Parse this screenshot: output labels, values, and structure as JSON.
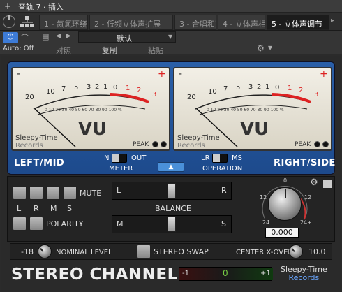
{
  "host": {
    "title": "音轨 7 · 插入",
    "tabs": [
      "1 - 氤氲环绕",
      "2 - 低频立体声扩展",
      "3 - 合唱和声",
      "4 - 立体声相",
      "5 - 立体声调节"
    ],
    "auto_label": "Auto: Off",
    "preset": "默认",
    "compare_label": "对照",
    "copy_label": "复制",
    "paste_label": "粘贴"
  },
  "meters": {
    "left": {
      "minus": "-",
      "plus": "+",
      "vu": "VU",
      "peak": "PEAK",
      "brand": "Sleepy-Time",
      "brand_sub": "Records",
      "scale_top": [
        "20",
        "10",
        "7",
        "5",
        "3",
        "2",
        "1",
        "0",
        "1",
        "2",
        "3"
      ],
      "scale_pct": "0 10 20 30 40 50 60 70 80 90 100 %"
    },
    "right": {
      "minus": "-",
      "plus": "+",
      "vu": "VU",
      "peak": "PEAK",
      "brand": "Sleepy-Time",
      "brand_sub": "Records",
      "scale_top": [
        "20",
        "10",
        "7",
        "5",
        "3",
        "2",
        "1",
        "0",
        "1",
        "2",
        "3"
      ],
      "scale_pct": "0 10 20 30 40 50 60 70 80 90 100 %"
    }
  },
  "meter_section": {
    "left_label": "LEFT/MID",
    "right_label": "RIGHT/SIDE",
    "meter_in": "IN",
    "meter_out": "OUT",
    "meter_label": "METER",
    "op_lr": "LR",
    "op_ms": "MS",
    "operation_label": "OPERATION"
  },
  "mute": {
    "label": "MUTE",
    "channels": [
      "L",
      "R",
      "M",
      "S"
    ]
  },
  "polarity": {
    "label": "POLARITY"
  },
  "balance": {
    "label": "BALANCE",
    "l": "L",
    "r": "R",
    "m": "M",
    "s": "S",
    "lr_value": 0.5,
    "ms_value": 0.5
  },
  "gain": {
    "readout": "0.000",
    "scale": [
      "0",
      "12",
      "12",
      "24",
      "24+"
    ]
  },
  "bottom": {
    "nominal_value": "-18",
    "nominal_label": "NOMINAL LEVEL",
    "swap_label": "STEREO SWAP",
    "xover_label": "CENTER X-OVER",
    "xover_value": "10.0"
  },
  "footer": {
    "title": "STEREO CHANNEL",
    "corr_min": "-1",
    "corr_mid": "0",
    "corr_max": "+1",
    "brand": "Sleepy-Time",
    "brand_sub": "Records"
  },
  "colors": {
    "panel_blue": "#2a5fa8",
    "red_scale": "#d22",
    "accent": "#4a90d9"
  }
}
